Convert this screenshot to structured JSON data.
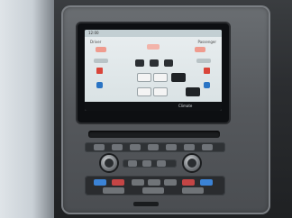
{
  "screen": {
    "status_left": "12:00",
    "status_right": "",
    "zone_left_label": "Driver",
    "zone_right_label": "Passenger",
    "bottom_label": "Climate"
  },
  "colors": {
    "accent_red": "#d9453a",
    "accent_blue": "#2a74c4",
    "screen_bg": "#e9eef0"
  }
}
